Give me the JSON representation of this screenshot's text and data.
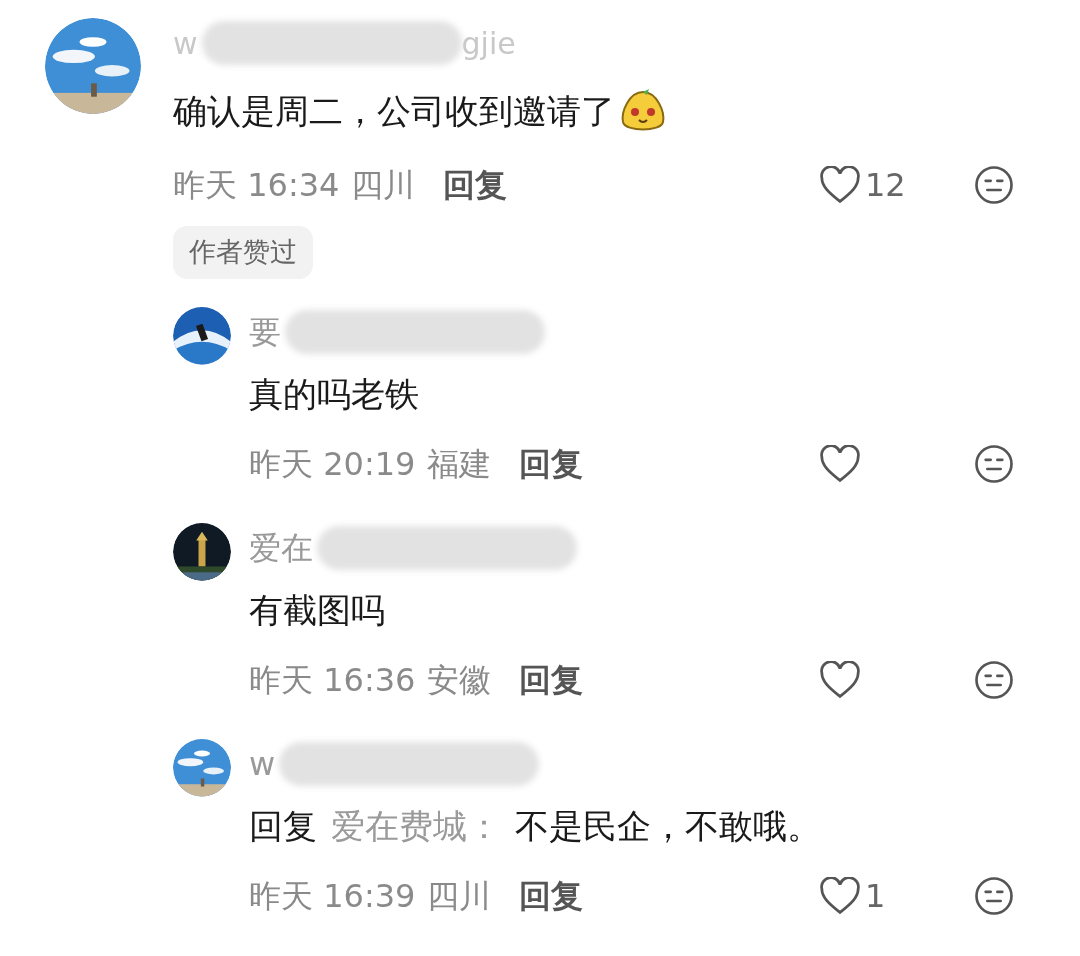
{
  "comment": {
    "username": "w",
    "username_tail": "gjie",
    "text": "确认是周二，公司收到邀请了",
    "meta": {
      "time": "昨天 16:34",
      "location": "四川",
      "reply": "回复",
      "likes": "12"
    },
    "badge": "作者赞过"
  },
  "replies": [
    {
      "username": "要",
      "text": [
        {
          "kind": "plain",
          "text": "真的吗老铁"
        }
      ],
      "meta": {
        "time": "昨天 20:19",
        "location": "福建",
        "reply": "回复"
      }
    },
    {
      "username": "爱在",
      "text": [
        {
          "kind": "plain",
          "text": "有截图吗"
        }
      ],
      "meta": {
        "time": "昨天 16:36",
        "location": "安徽",
        "reply": "回复"
      }
    },
    {
      "username": "w",
      "text": [
        {
          "kind": "plain",
          "text": "回复"
        },
        {
          "kind": "mention",
          "text": "爱在费城："
        },
        {
          "kind": "plain",
          "text": "不是民企，不敢哦。"
        }
      ],
      "meta": {
        "time": "昨天 16:39",
        "location": "四川",
        "reply": "回复",
        "likes": "1"
      }
    }
  ]
}
